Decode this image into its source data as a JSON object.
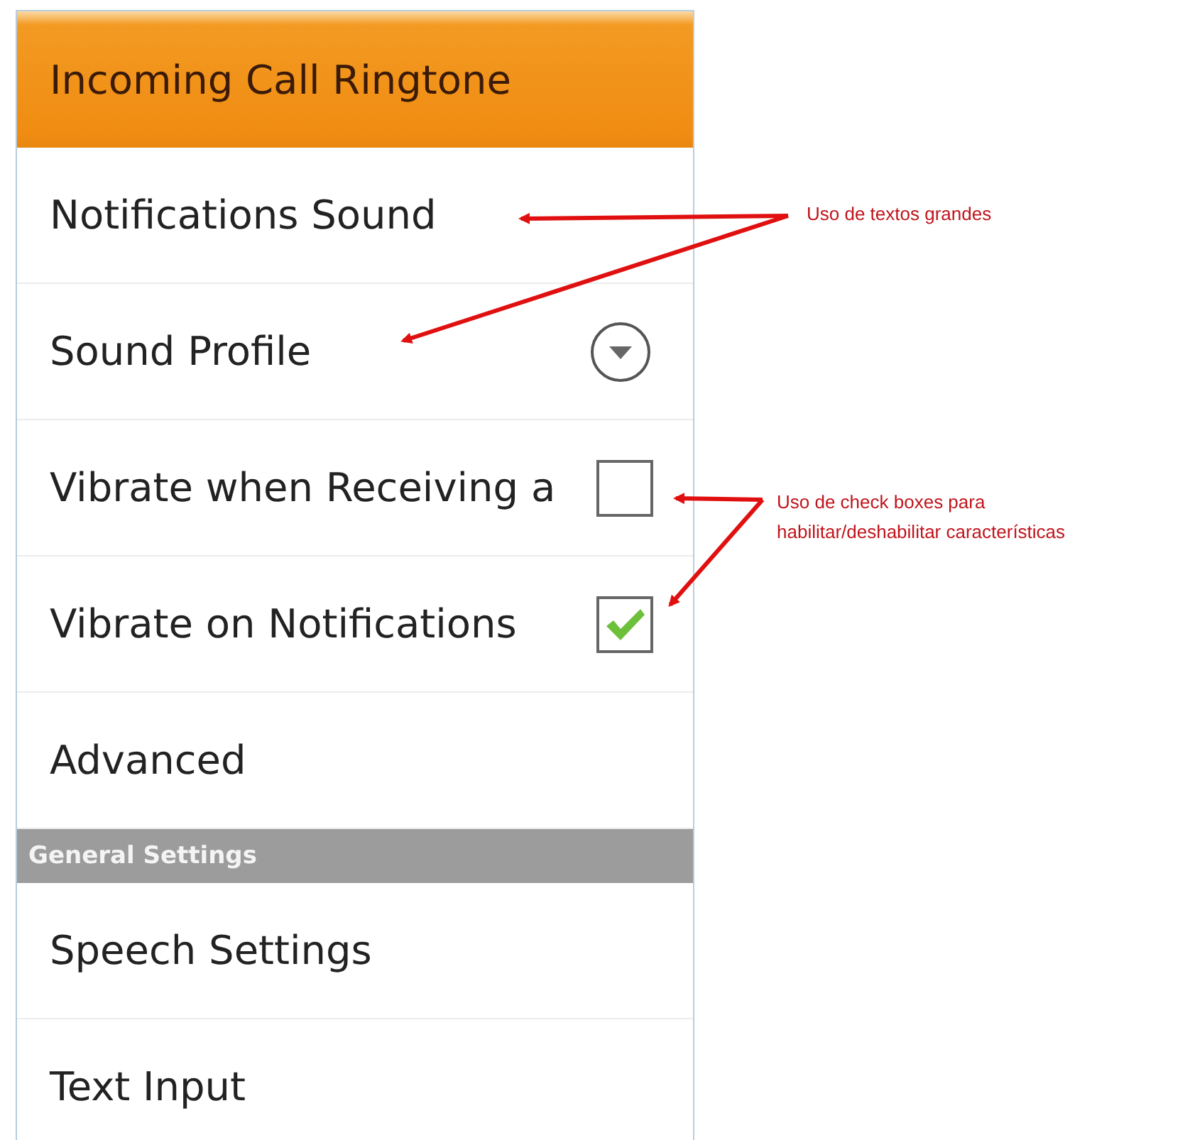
{
  "settings": [
    {
      "kind": "item",
      "label": "Incoming Call Ringtone",
      "selected": true
    },
    {
      "kind": "item",
      "label": "Notifications Sound",
      "selected": false
    },
    {
      "kind": "dropdown",
      "label": "Sound Profile",
      "selected": false
    },
    {
      "kind": "checkbox",
      "label": "Vibrate when Receiving a",
      "checked": false,
      "selected": false
    },
    {
      "kind": "checkbox",
      "label": "Vibrate on Notifications",
      "checked": true,
      "selected": false
    },
    {
      "kind": "item",
      "label": "Advanced",
      "selected": false
    },
    {
      "kind": "header",
      "label": "General Settings"
    },
    {
      "kind": "item",
      "label": "Speech Settings",
      "selected": false
    },
    {
      "kind": "item",
      "label": "Text Input",
      "selected": false
    }
  ],
  "annotations": [
    {
      "text": "Uso de textos grandes"
    },
    {
      "text": "Uso de check boxes para habilitar/deshabilitar características"
    }
  ]
}
